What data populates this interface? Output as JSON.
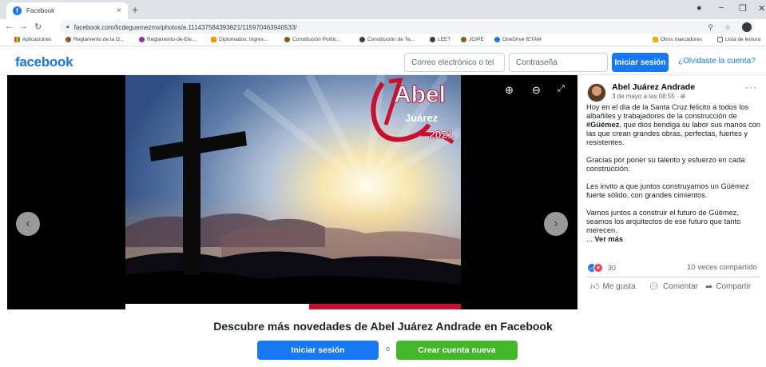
{
  "browser": {
    "tab_title": "Facebook",
    "tab_close": "×",
    "new_tab": "+",
    "url": "facebook.com/licdeguemezmx/photos/a.111437584393821/115970463940533/",
    "bookmarks": [
      {
        "label": "Aplicaciones",
        "color": "#5f6368"
      },
      {
        "label": "Reglamento de la O...",
        "color": "#8b5a2b"
      },
      {
        "label": "Reglamento-de-Ele...",
        "color": "#9c27b0"
      },
      {
        "label": "Diplomados: Ingres...",
        "color": "#f29900"
      },
      {
        "label": "Constitución Polític...",
        "color": "#8b5a2b"
      },
      {
        "label": "Constitución de Ta...",
        "color": "#3c4043"
      },
      {
        "label": "LEET",
        "color": "#3c4043"
      },
      {
        "label": "JGIPE",
        "color": "#8b5a2b"
      },
      {
        "label": "OneDrive IETAM",
        "color": "#1a73e8"
      }
    ],
    "other_bookmarks": "Otros marcadores",
    "reading_list": "Lista de lectura"
  },
  "header": {
    "logo": "facebook",
    "email_placeholder": "Correo electrónico o tel",
    "password_placeholder": "Contraseña",
    "login_label": "Iniciar sesión",
    "forgot_label": "¿Olvidaste la cuenta?"
  },
  "photo": {
    "brand_name": "Abel",
    "brand_surname": "Juárez",
    "brand_year": "2021"
  },
  "post": {
    "author": "Abel Juárez Andrade",
    "date": "3 de mayo a las 08:55 · ",
    "more": "···",
    "p1_pre": "Hoy en el día de la Santa Cruz felicito a todos los albañiles y trabajadores de la construcción de ",
    "p1_tag": "#Güémez",
    "p1_post": ", que dios bendiga su labor sus manos con las que crean grandes obras, perfectas, fuertes y resistentes.",
    "p2": "Gracias por poner su talento y esfuerzo en cada construcción.",
    "p3": "Les invito a que juntos construyamos un Güémez fuerte sólido, con grandes cimientos.",
    "p4": "Vamos juntos a construir el futuro de Güémez, seamos los arquitectos de ese futuro que tanto merecen.",
    "ellipsis": "... ",
    "see_more": "Ver más",
    "reaction_count": "30",
    "shares": "10 veces compartido",
    "like_label": "Me gusta",
    "comment_label": "Comentar",
    "share_label": "Compartir"
  },
  "footer": {
    "title": "Descubre más novedades de Abel Juárez Andrade en Facebook",
    "login_label": "Iniciar sesión",
    "or_label": "o",
    "create_label": "Crear cuenta nueva"
  },
  "colors": {
    "brand_blue": "#1877f2",
    "green": "#42b72a",
    "brand_red": "#c8102e"
  }
}
